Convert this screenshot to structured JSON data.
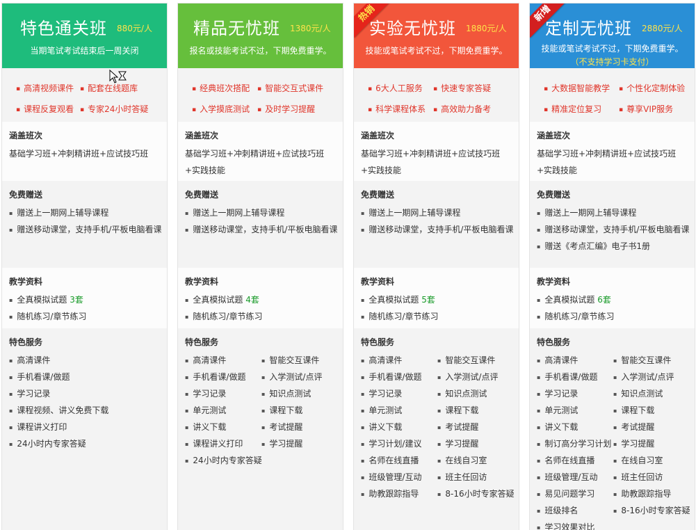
{
  "labels": {
    "covered": "涵盖班次",
    "gifts": "免费赠送",
    "materials": "教学资料",
    "services": "特色服务"
  },
  "plans": [
    {
      "name": "特色通关班",
      "price": "880元/人",
      "desc": "当期笔试考试结束后一周关闭",
      "note": "",
      "ribbon": "",
      "features": [
        "高清视频课件",
        "配套在线题库",
        "课程反复观看",
        "专家24小时答疑"
      ],
      "covered": "基础学习班+冲刺精讲班+应试技巧班",
      "gifts": [
        "赠送上一期网上辅导课程",
        "赠送移动课堂，支持手机/平板电脑看课"
      ],
      "materials": {
        "mock_prefix": "全真模拟试题 ",
        "mock_count": "3套",
        "practice": "随机练习/章节练习"
      },
      "services_left": [
        "高清课件",
        "手机看课/做题",
        "学习记录",
        "课程视频、讲义免费下载",
        "课程讲义打印",
        "24小时内专家答疑"
      ],
      "services_right": []
    },
    {
      "name": "精品无忧班",
      "price": "1380元/人",
      "desc": "报名或技能考试不过，下期免费重学。",
      "note": "",
      "ribbon": "",
      "features": [
        "经典班次搭配",
        "智能交互式课件",
        "入学摸底测试",
        "及时学习提醒"
      ],
      "covered": "基础学习班+冲刺精讲班+应试技巧班+实践技能",
      "gifts": [
        "赠送上一期网上辅导课程",
        "赠送移动课堂，支持手机/平板电脑看课"
      ],
      "materials": {
        "mock_prefix": "全真模拟试题 ",
        "mock_count": "4套",
        "practice": "随机练习/章节练习"
      },
      "services_left": [
        "高清课件",
        "手机看课/做题",
        "学习记录",
        "单元测试",
        "讲义下载",
        "课程讲义打印",
        "24小时内专家答疑"
      ],
      "services_right": [
        "智能交互课件",
        "入学测试/点评",
        "知识点测试",
        "课程下载",
        "考试提醒",
        "学习提醒"
      ]
    },
    {
      "name": "实验无忧班",
      "price": "1880元/人",
      "desc": "技能或笔试考试不过，下期免费重学。",
      "note": "",
      "ribbon": "热销",
      "features": [
        "6大人工服务",
        "快速专家答疑",
        "科学课程体系",
        "高效助力备考"
      ],
      "covered": "基础学习班+冲刺精讲班+应试技巧班+实践技能",
      "gifts": [
        "赠送上一期网上辅导课程",
        "赠送移动课堂，支持手机/平板电脑看课"
      ],
      "materials": {
        "mock_prefix": "全真模拟试题 ",
        "mock_count": "5套",
        "practice": "随机练习/章节练习"
      },
      "services_left": [
        "高清课件",
        "手机看课/做题",
        "学习记录",
        "单元测试",
        "讲义下载",
        "学习计划/建议",
        "名师在线直播",
        "班级管理/互动",
        "助教跟踪指导"
      ],
      "services_right": [
        "智能交互课件",
        "入学测试/点评",
        "知识点测试",
        "课程下载",
        "考试提醒",
        "学习提醒",
        "在线自习室",
        "班主任回访",
        "8-16小时专家答疑"
      ]
    },
    {
      "name": "定制无忧班",
      "price": "2880元/人",
      "desc": "技能或笔试考试不过，下期免费重学。",
      "note": "（不支持学习卡支付）",
      "ribbon": "新增",
      "features": [
        "大数据智能教学",
        "个性化定制体验",
        "精准定位复习",
        "尊享VIP服务"
      ],
      "covered": "基础学习班+冲刺精讲班+应试技巧班+实践技能",
      "gifts": [
        "赠送上一期网上辅导课程",
        "赠送移动课堂，支持手机/平板电脑看课",
        "赠送《考点汇编》电子书1册"
      ],
      "materials": {
        "mock_prefix": "全真模拟试题 ",
        "mock_count": "6套",
        "practice": "随机练习/章节练习"
      },
      "services_left": [
        "高清课件",
        "手机看课/做题",
        "学习记录",
        "单元测试",
        "讲义下载",
        "制订高分学习计划",
        "名师在线直播",
        "班级管理/互动",
        "易见问题学习",
        "班级排名",
        "学习效果对比"
      ],
      "services_right": [
        "智能交互课件",
        "入学测试/点评",
        "知识点测试",
        "课程下载",
        "考试提醒",
        "学习提醒",
        "在线自习室",
        "班主任回访",
        "助教跟踪指导",
        "8-16小时专家答疑"
      ]
    }
  ],
  "colors": {
    "green": "#1ebc7c",
    "lime": "#66bf3c",
    "red": "#f2563b",
    "blue": "#2a8fd6",
    "feature_text": "#e0362b",
    "highlight": "#1a9b2a",
    "price": "#ffe34a"
  },
  "icons": {
    "cursor": "cursor-icon"
  }
}
